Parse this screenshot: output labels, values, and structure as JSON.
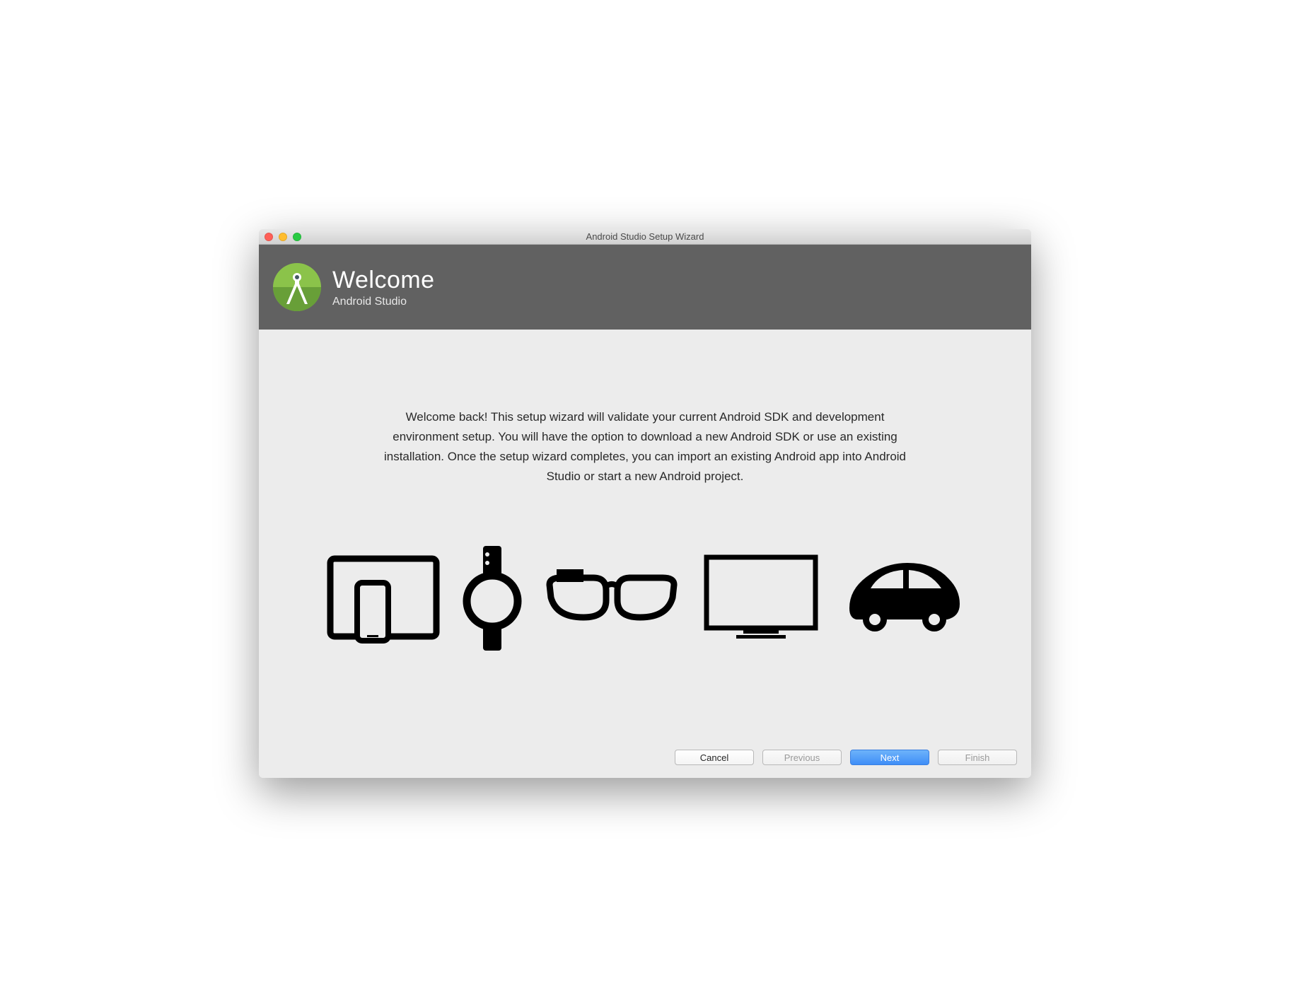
{
  "window": {
    "title": "Android Studio Setup Wizard"
  },
  "header": {
    "title": "Welcome",
    "subtitle": "Android Studio"
  },
  "body": {
    "text": "Welcome back! This setup wizard will validate your current Android SDK and development environment setup. You will have the option to download a new Android SDK or use an existing installation. Once the setup wizard completes, you can import an existing Android app into Android Studio or start a new Android project."
  },
  "icons": {
    "tablet_phone": "tablet-phone-icon",
    "watch": "watch-icon",
    "glass": "glasses-icon",
    "tv": "tv-icon",
    "car": "car-icon"
  },
  "footer": {
    "cancel": "Cancel",
    "previous": "Previous",
    "next": "Next",
    "finish": "Finish"
  }
}
